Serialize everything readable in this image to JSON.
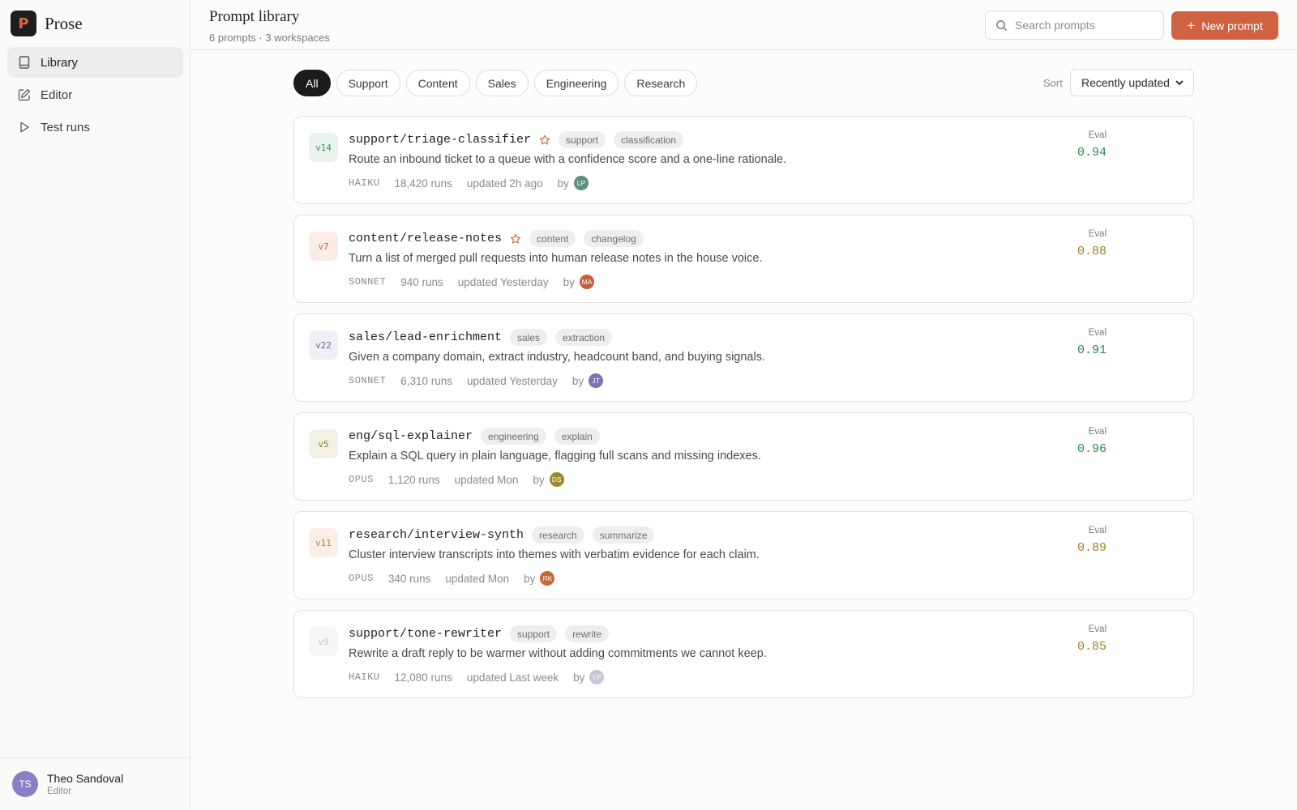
{
  "app": {
    "name": "Prose",
    "logo_letter": "P"
  },
  "nav": [
    {
      "label": "Library",
      "icon": "book-icon",
      "active": true
    },
    {
      "label": "Editor",
      "icon": "pencil-square-icon",
      "active": false
    },
    {
      "label": "Test runs",
      "icon": "play-icon",
      "active": false
    }
  ],
  "user": {
    "initials": "TS",
    "name": "Theo Sandoval",
    "role": "Editor"
  },
  "header": {
    "title": "Prompt library",
    "subtitle": "6 prompts · 3 workspaces",
    "search_placeholder": "Search prompts",
    "new_button": "New prompt"
  },
  "filters": [
    "All",
    "Support",
    "Content",
    "Sales",
    "Engineering",
    "Research"
  ],
  "sort": {
    "label": "Sort",
    "value": "Recently updated"
  },
  "colors": {
    "accent": "#cf6241",
    "eval_green": "#2f8a4a",
    "eval_amber": "#a0812a"
  },
  "prompts": [
    {
      "version": "v14",
      "version_bg": "#e9f3ee",
      "version_color": "#4e8a6c",
      "name": "support/triage-classifier",
      "starred": true,
      "tags": [
        "support",
        "classification"
      ],
      "description": "Route an inbound ticket to a queue with a confidence score and a one-line rationale.",
      "model": "HAIKU",
      "runs": "18,420 runs",
      "updated": "updated 2h ago",
      "by": "by",
      "author_initials": "LP",
      "author_color": "#5d8f82",
      "eval_label": "Eval",
      "eval": "0.94",
      "eval_tone": "green"
    },
    {
      "version": "v7",
      "version_bg": "#fbece6",
      "version_color": "#c0664a",
      "name": "content/release-notes",
      "starred": true,
      "tags": [
        "content",
        "changelog"
      ],
      "description": "Turn a list of merged pull requests into human release notes in the house voice.",
      "model": "SONNET",
      "runs": "940 runs",
      "updated": "updated Yesterday",
      "by": "by",
      "author_initials": "MA",
      "author_color": "#c65d3e",
      "eval_label": "Eval",
      "eval": "0.88",
      "eval_tone": "amber"
    },
    {
      "version": "v22",
      "version_bg": "#efeff5",
      "version_color": "#6d6d84",
      "name": "sales/lead-enrichment",
      "starred": false,
      "tags": [
        "sales",
        "extraction"
      ],
      "description": "Given a company domain, extract industry, headcount band, and buying signals.",
      "model": "SONNET",
      "runs": "6,310 runs",
      "updated": "updated Yesterday",
      "by": "by",
      "author_initials": "JT",
      "author_color": "#7c73b4",
      "eval_label": "Eval",
      "eval": "0.91",
      "eval_tone": "green"
    },
    {
      "version": "v5",
      "version_bg": "#f3f1e4",
      "version_color": "#8a7a3a",
      "name": "eng/sql-explainer",
      "starred": false,
      "tags": [
        "engineering",
        "explain"
      ],
      "description": "Explain a SQL query in plain language, flagging full scans and missing indexes.",
      "model": "OPUS",
      "runs": "1,120 runs",
      "updated": "updated Mon",
      "by": "by",
      "author_initials": "DS",
      "author_color": "#9a8a2e",
      "eval_label": "Eval",
      "eval": "0.96",
      "eval_tone": "green"
    },
    {
      "version": "v11",
      "version_bg": "#fbeee4",
      "version_color": "#c0784a",
      "name": "research/interview-synth",
      "starred": false,
      "tags": [
        "research",
        "summarize"
      ],
      "description": "Cluster interview transcripts into themes with verbatim evidence for each claim.",
      "model": "OPUS",
      "runs": "340 runs",
      "updated": "updated Mon",
      "by": "by",
      "author_initials": "RK",
      "author_color": "#c66a35",
      "eval_label": "Eval",
      "eval": "0.89",
      "eval_tone": "amber"
    },
    {
      "version": "v9",
      "version_bg": "#f6f6f5",
      "version_color": "#c4c4c4",
      "name": "support/tone-rewriter",
      "starred": false,
      "tags": [
        "support",
        "rewrite"
      ],
      "description": "Rewrite a draft reply to be warmer without adding commitments we cannot keep.",
      "model": "HAIKU",
      "runs": "12,080 runs",
      "updated": "updated Last week",
      "by": "by",
      "author_initials": "LP",
      "author_color": "#c9c5d3",
      "eval_label": "Eval",
      "eval": "0.85",
      "eval_tone": "amber"
    }
  ]
}
